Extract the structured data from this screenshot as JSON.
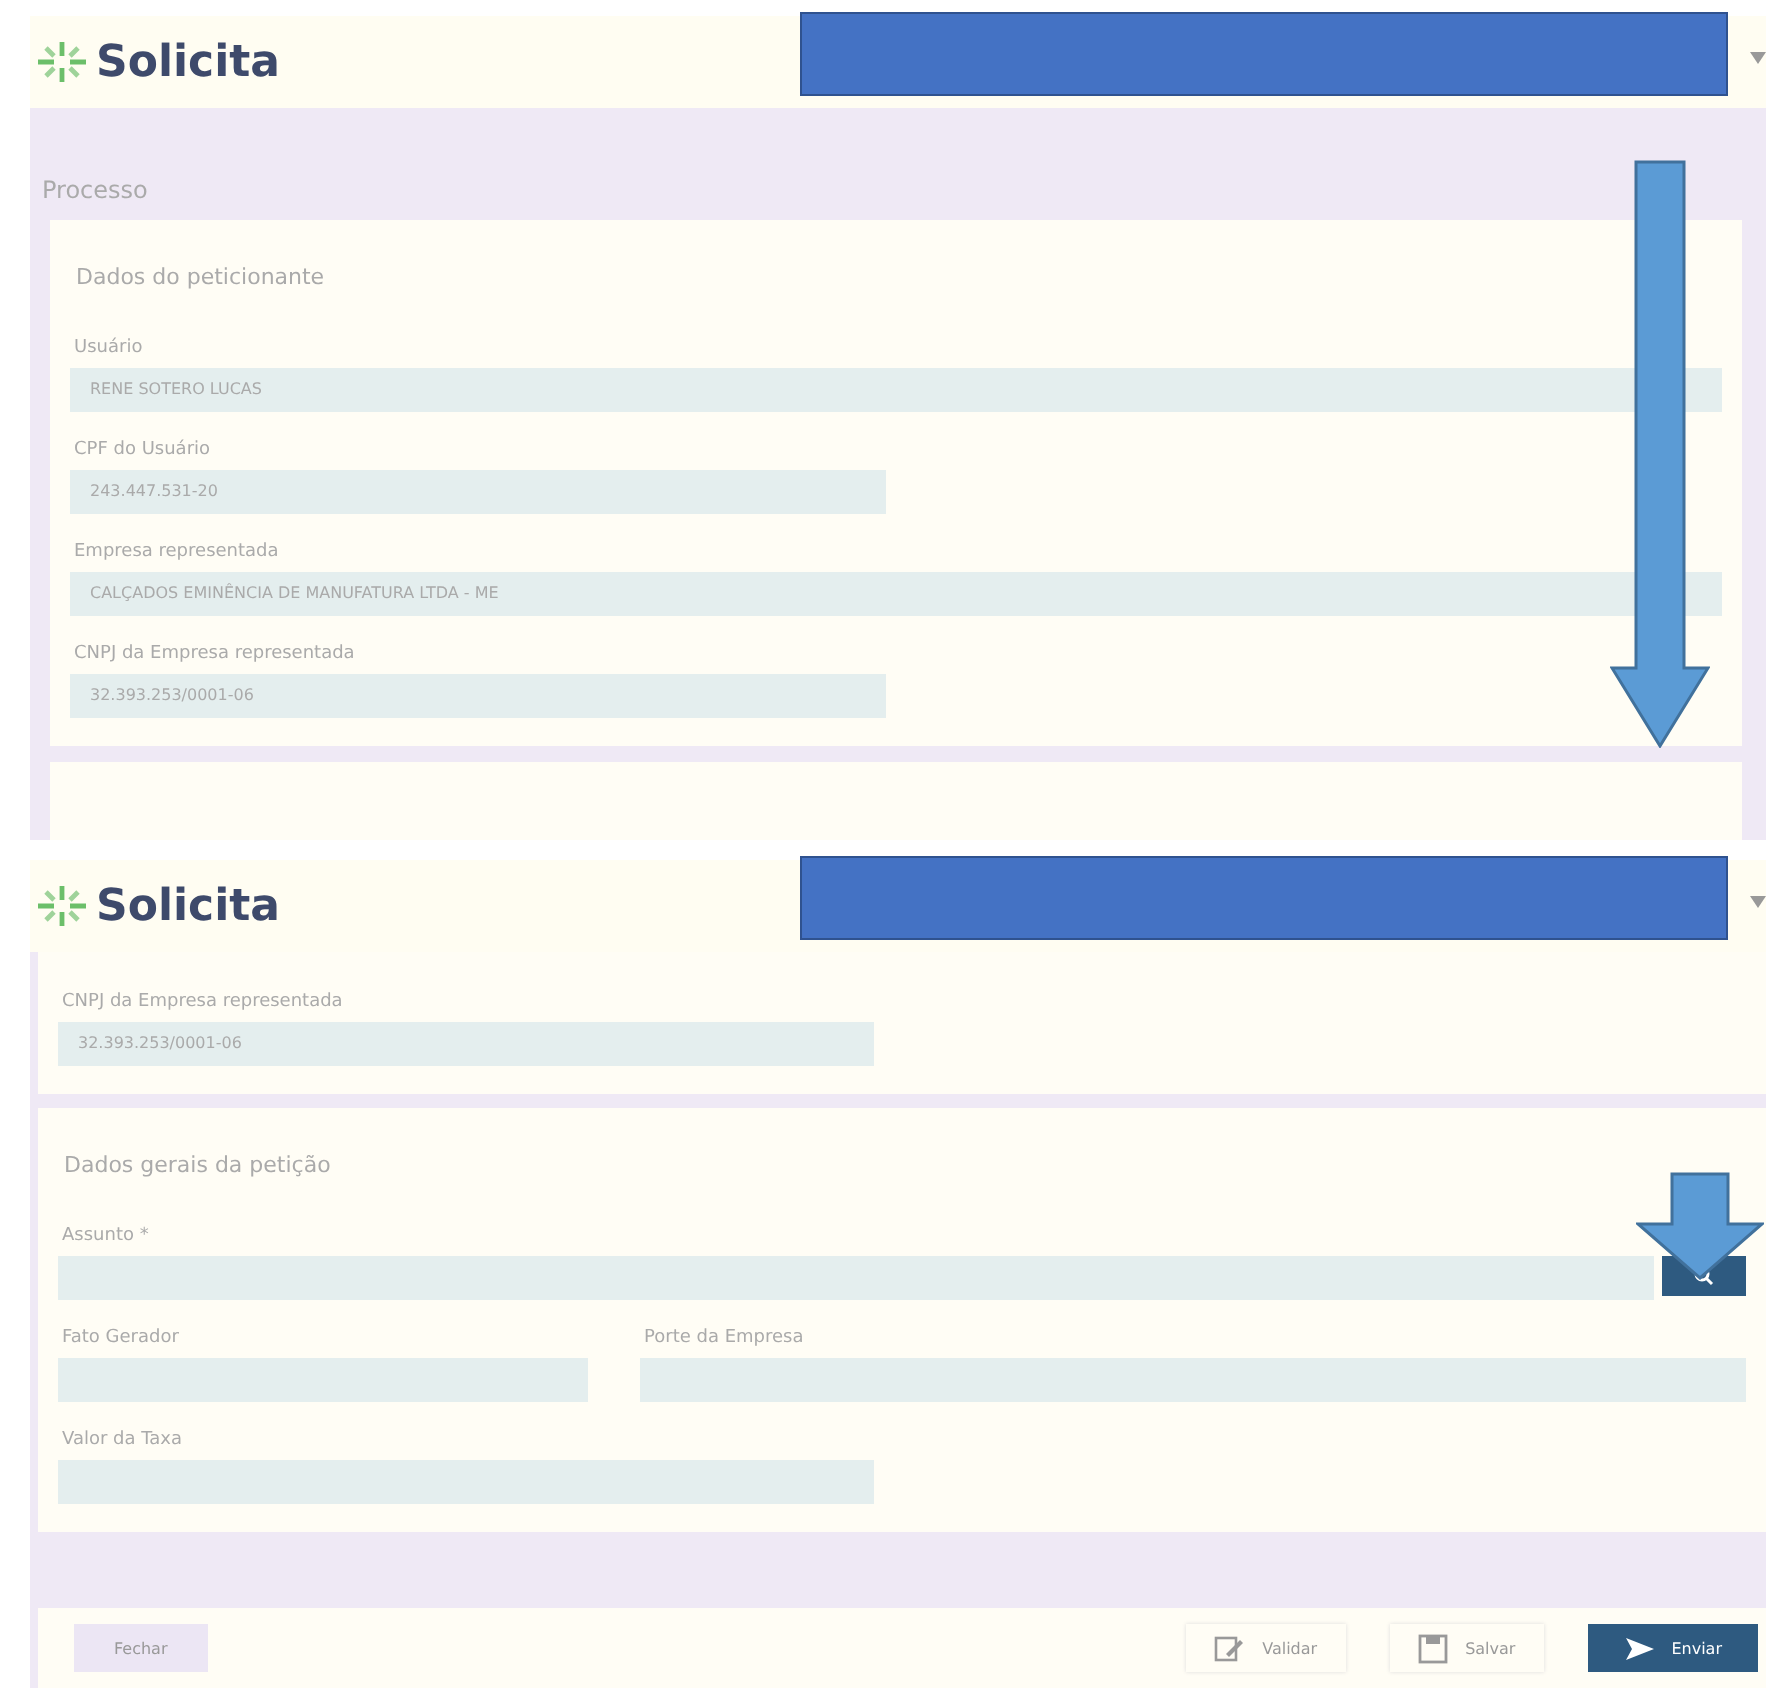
{
  "screens": [
    {
      "logo": "Solicita",
      "page_title": "Processo",
      "sections": [
        {
          "title": "Dados do peticionante",
          "rows": [
            [
              {
                "label": "Usuário",
                "value": "RENE SOTERO LUCAS",
                "kind": "full"
              }
            ],
            [
              {
                "label": "CPF do Usuário",
                "value": "243.447.531-20",
                "kind": "half"
              }
            ],
            [
              {
                "label": "Empresa representada",
                "value": "CALÇADOS EMINÊNCIA DE MANUFATURA LTDA - ME",
                "kind": "full"
              }
            ],
            [
              {
                "label": "CNPJ da Empresa representada",
                "value": "32.393.253/0001-06",
                "kind": "half"
              }
            ]
          ]
        }
      ]
    },
    {
      "logo": "Solicita",
      "sections": [
        {
          "rows": [
            [
              {
                "label": "CNPJ da Empresa representada",
                "value": "32.393.253/0001-06",
                "kind": "half"
              }
            ]
          ]
        },
        {
          "title": "Dados gerais da petição",
          "rows": [
            [
              {
                "label": "Assunto *",
                "kind": "search"
              }
            ],
            [
              {
                "label": "Fato Gerador",
                "kind": "col"
              },
              {
                "label": "Porte da Empresa",
                "kind": "wide"
              }
            ],
            [
              {
                "label": "Valor da Taxa",
                "kind": "half"
              }
            ]
          ]
        }
      ],
      "buttons": [
        {
          "label": "Fechar",
          "kind": "close"
        },
        {
          "label": "Validar",
          "kind": "validate"
        },
        {
          "label": "Salvar",
          "kind": "save"
        },
        {
          "label": "Enviar",
          "kind": "send"
        }
      ]
    }
  ]
}
